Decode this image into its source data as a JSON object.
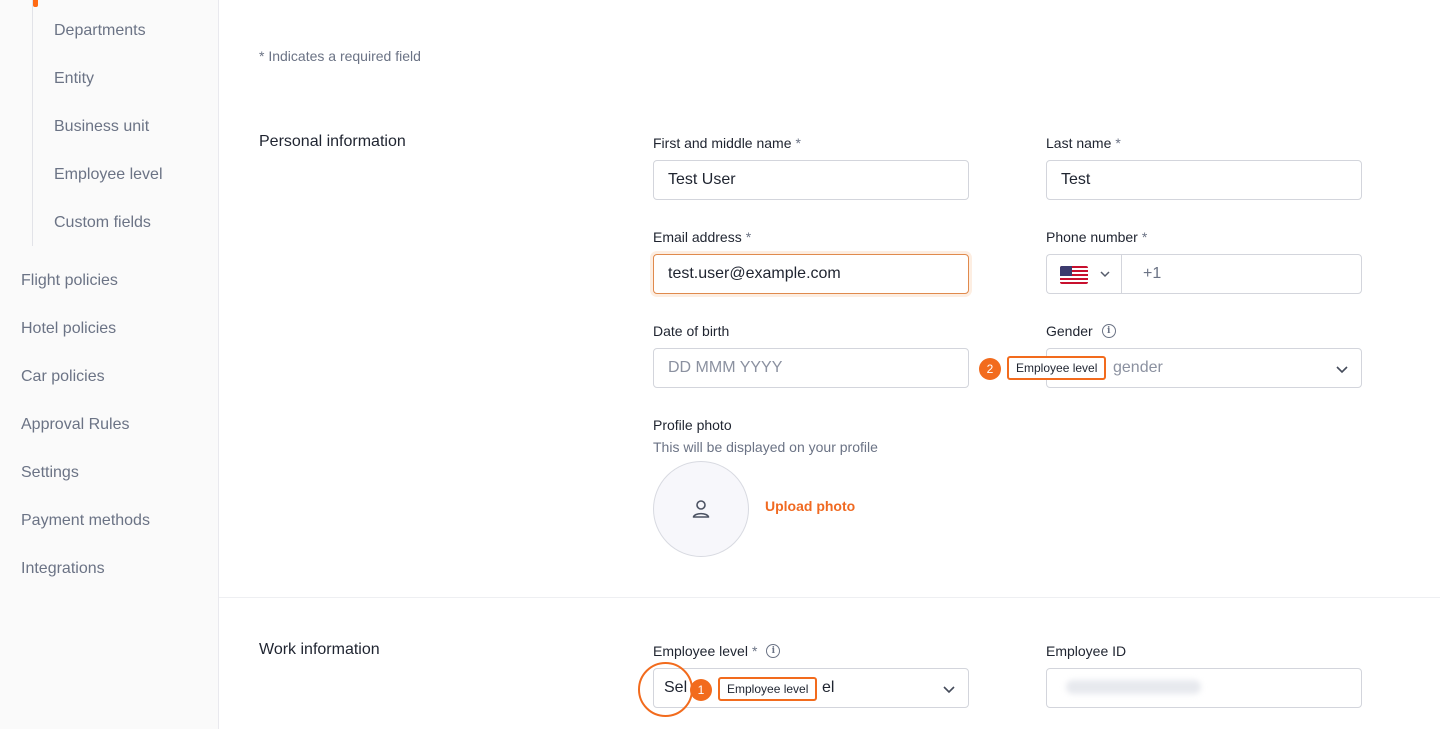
{
  "sidebar": {
    "sub_items": [
      "Departments",
      "Entity",
      "Business unit",
      "Employee level",
      "Custom fields"
    ],
    "items": [
      "Flight policies",
      "Hotel policies",
      "Car policies",
      "Approval Rules",
      "Settings",
      "Payment methods",
      "Integrations"
    ]
  },
  "required_note": "* Indicates a required field",
  "personal": {
    "title": "Personal information",
    "first_name": {
      "label": "First and middle name",
      "required": "*",
      "value": "Test User"
    },
    "last_name": {
      "label": "Last name",
      "required": "*",
      "value": "Test"
    },
    "email": {
      "label": "Email address",
      "required": "*",
      "value": "test.user@example.com"
    },
    "phone": {
      "label": "Phone number",
      "required": "*",
      "country_icon": "us-flag-icon",
      "code": "+1"
    },
    "dob": {
      "label": "Date of birth",
      "placeholder": "DD MMM YYYY"
    },
    "gender": {
      "label": "Gender",
      "placeholder_visible": "gender"
    },
    "photo": {
      "label": "Profile photo",
      "description": "This will be displayed on your profile",
      "upload": "Upload photo"
    }
  },
  "work": {
    "title": "Work information",
    "employee_level": {
      "label": "Employee level",
      "required": "*",
      "visible_text_left": "Sel",
      "visible_text_right": "el"
    },
    "employee_id": {
      "label": "Employee ID"
    }
  },
  "annotations": [
    {
      "number": "1",
      "text": "Employee level"
    },
    {
      "number": "2",
      "text": "Employee level"
    }
  ],
  "colors": {
    "accent": "#f26b1d",
    "text": "#1f2430",
    "muted": "#6b7385",
    "border": "#d3d5dc"
  }
}
